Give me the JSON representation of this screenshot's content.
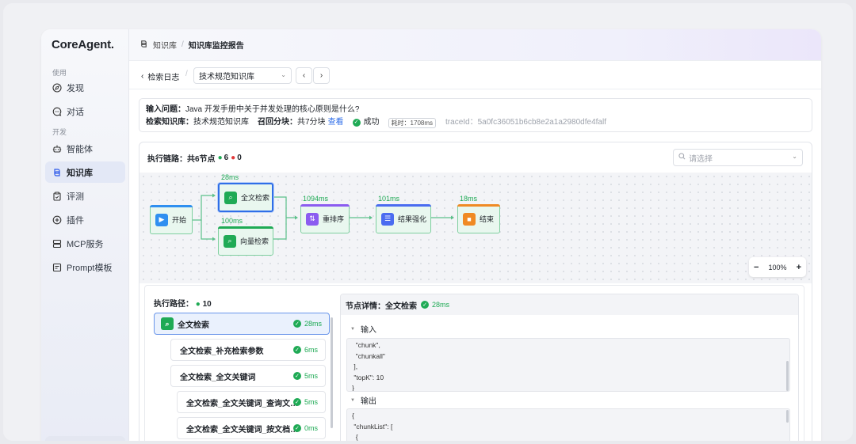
{
  "app": {
    "logo": "CoreAgent."
  },
  "sidebar": {
    "sections": [
      {
        "label": "使用"
      },
      {
        "label": "开发"
      }
    ],
    "items": [
      {
        "label": "发现",
        "icon": "compass-icon"
      },
      {
        "label": "对话",
        "icon": "chat-icon"
      },
      {
        "label": "智能体",
        "icon": "robot-icon"
      },
      {
        "label": "知识库",
        "icon": "knowledge-icon"
      },
      {
        "label": "评测",
        "icon": "clipboard-icon"
      },
      {
        "label": "插件",
        "icon": "plugin-icon"
      },
      {
        "label": "MCP服务",
        "icon": "server-icon"
      },
      {
        "label": "Prompt模板",
        "icon": "template-icon"
      }
    ],
    "active": "知识库"
  },
  "breadcrumb": {
    "root": "知识库",
    "sep": "/",
    "current": "知识库监控报告"
  },
  "toolbar": {
    "back_label": "检索日志",
    "sep": "/",
    "kb_select": "技术规范知识库",
    "prev": "‹",
    "next": "›"
  },
  "query": {
    "question_label": "输入问题：",
    "question": "Java 开发手册中关于并发处理的核心原则是什么?",
    "kb_label": "检索知识库：",
    "kb": "技术规范知识库",
    "recall_label": "召回分块：",
    "recall": "共7分块",
    "view_link": "查看",
    "status": "成功",
    "duration": "耗时：1708ms",
    "trace": "traceId：5a0fc36051b6cb8e2a1a2980dfe4falf"
  },
  "chain": {
    "title": "执行链路：共6节点",
    "ok_count": "6",
    "err_count": "0",
    "filter_placeholder": "请选择",
    "zoom": "100%",
    "zoom_minus": "−",
    "zoom_plus": "+",
    "nodes": [
      {
        "label": "开始",
        "ms": ""
      },
      {
        "label": "全文检索",
        "ms": "28ms"
      },
      {
        "label": "向量检索",
        "ms": "100ms"
      },
      {
        "label": "重排序",
        "ms": "1094ms"
      },
      {
        "label": "结果强化",
        "ms": "101ms"
      },
      {
        "label": "结束",
        "ms": "18ms"
      }
    ],
    "colors": {
      "success": "#1faa55",
      "error": "#e2383a",
      "accent": "#2f6ee8"
    }
  },
  "path": {
    "title": "执行路径：",
    "count": "10",
    "items": [
      {
        "label": "全文检索",
        "ms": "28ms"
      },
      {
        "label": "全文检索_补充检索参数",
        "ms": "6ms"
      },
      {
        "label": "全文检索_全文关键词",
        "ms": "5ms"
      },
      {
        "label": "全文检索_全文关键词_查询文…",
        "ms": "5ms"
      },
      {
        "label": "全文检索_全文关键词_按文档…",
        "ms": "0ms"
      }
    ]
  },
  "detail": {
    "title": "节点详情：全文检索",
    "ms": "28ms",
    "input_label": "输入",
    "input_code": "  \"chunk\",\n  \"chunkall\"\n ],\n \"topK\": 10\n}",
    "output_label": "输出",
    "output_code": "{\n \"chunkList\": [\n  {"
  }
}
